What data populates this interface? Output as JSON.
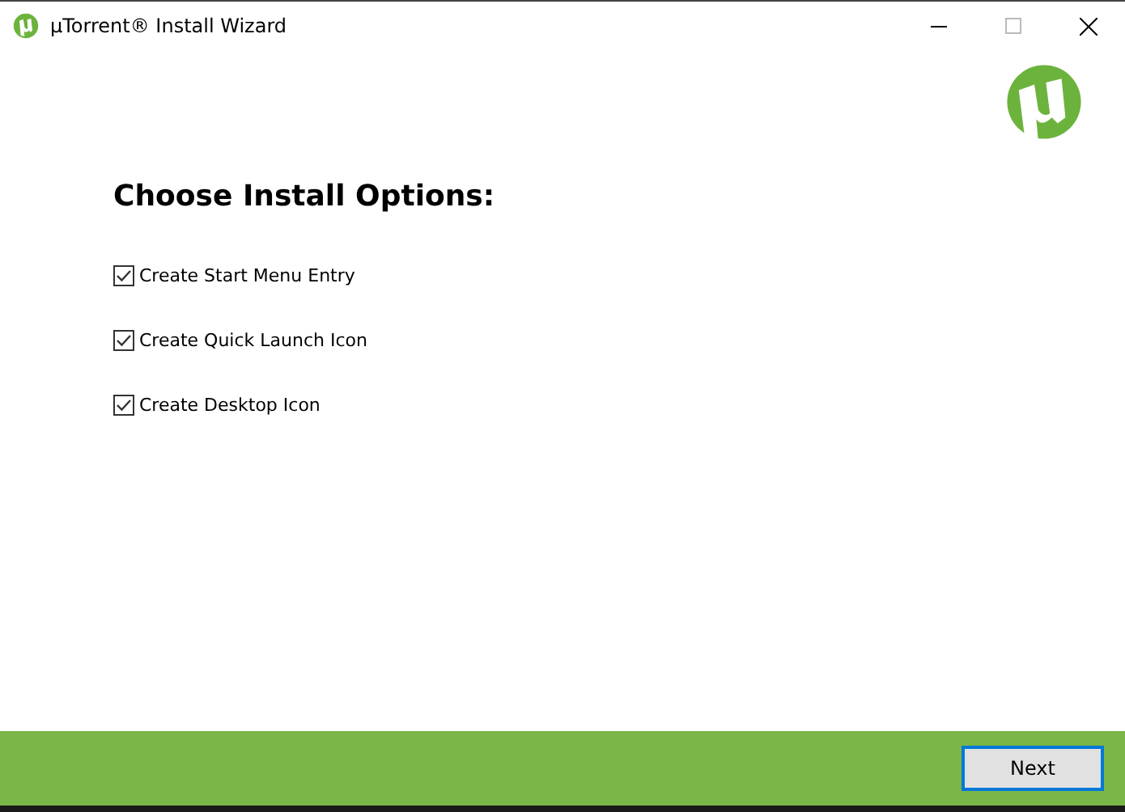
{
  "window": {
    "title": "µTorrent® Install Wizard"
  },
  "heading": "Choose Install Options:",
  "options": [
    {
      "label": "Create Start Menu Entry",
      "checked": true
    },
    {
      "label": "Create Quick Launch Icon",
      "checked": true
    },
    {
      "label": "Create Desktop Icon",
      "checked": true
    }
  ],
  "buttons": [
    {
      "label": "Next",
      "focused": true
    }
  ]
}
